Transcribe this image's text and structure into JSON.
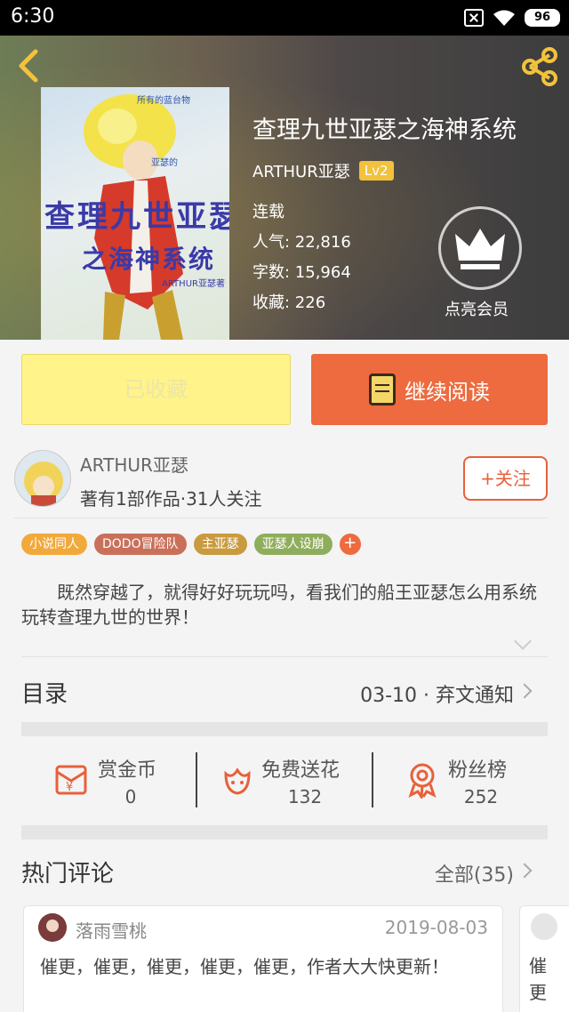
{
  "status_bar": {
    "time": "6:30",
    "battery": "96"
  },
  "book": {
    "title": "查理九世亚瑟之海神系统",
    "author": "ARTHUR亚瑟",
    "level": "Lv2",
    "status": "连载",
    "popularity": "人气: 22,816",
    "word_count": "字数: 15,964",
    "favorites": "收藏: 226",
    "cover_title_line1": "查理九世亚瑟",
    "cover_title_line2": "之海神系统",
    "cover_author": "ARTHUR亚瑟著"
  },
  "vip": {
    "label": "点亮会员"
  },
  "actions": {
    "collected_label": "已收藏",
    "read_label": "继续阅读"
  },
  "author_card": {
    "name": "ARTHUR亚瑟",
    "stats": "著有1部作品·31人关注",
    "follow_label": "+关注"
  },
  "tags": [
    {
      "label": "小说同人",
      "color": "#f2a93b"
    },
    {
      "label": "DODO冒险队",
      "color": "#c9705a"
    },
    {
      "label": "主亚瑟",
      "color": "#c99a3e"
    },
    {
      "label": "亚瑟人设崩",
      "color": "#8fae5d"
    }
  ],
  "tag_more": "+",
  "intro": "既然穿越了，就得好好玩玩吗，看我们的船王亚瑟怎么用系统玩转查理九世的世界！",
  "toc": {
    "label": "目录",
    "latest": "03-10 · 弃文通知"
  },
  "stats": [
    {
      "name": "赏金币",
      "value": "0",
      "icon": "gold-coin-icon"
    },
    {
      "name": "免费送花",
      "value": "132",
      "icon": "flower-icon"
    },
    {
      "name": "粉丝榜",
      "value": "252",
      "icon": "medal-icon"
    }
  ],
  "comments": {
    "label": "热门评论",
    "all_label": "全部(35)",
    "items": [
      {
        "user": "落雨雪桃",
        "date": "2019-08-03",
        "text": "催更，催更，催更，催更，催更，作者大大快更新！"
      },
      {
        "user": "",
        "date": "",
        "text": "催更"
      }
    ]
  },
  "colors": {
    "accent": "#ed6b3f",
    "collected_bg": "#fff38a",
    "level_badge": "#f2c23c"
  }
}
